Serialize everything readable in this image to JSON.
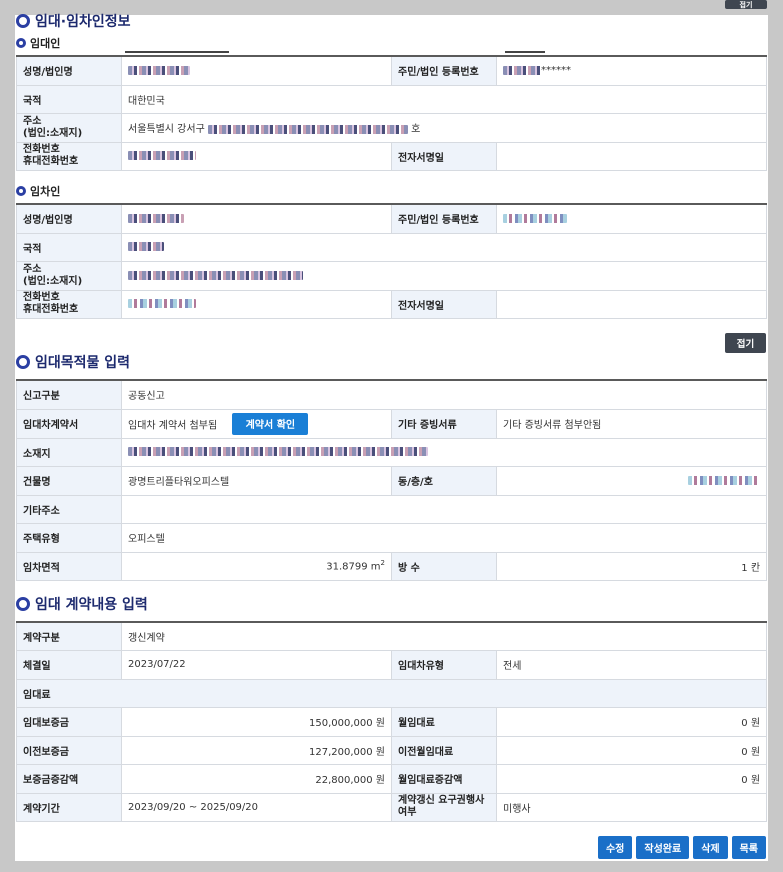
{
  "fold_label": "접기",
  "section1": {
    "title": "임대·임차인정보",
    "lessor": {
      "title": "임대인",
      "name_label": "성명/법인명",
      "regno_label": "주민/법인 등록번호",
      "regno_suffix": "******",
      "nationality_label": "국적",
      "nationality": "대한민국",
      "address_label": "주소\n(법인:소재지)",
      "address_prefix": "서울특별시 강서구",
      "address_suffix": "호",
      "phone_label": "전화번호\n휴대전화번호",
      "esign_label": "전자서명일",
      "esign": ""
    },
    "lessee": {
      "title": "임차인",
      "name_label": "성명/법인명",
      "regno_label": "주민/법인 등록번호",
      "nationality_label": "국적",
      "address_label": "주소\n(법인:소재지)",
      "phone_label": "전화번호\n휴대전화번호",
      "esign_label": "전자서명일",
      "esign": ""
    }
  },
  "section2": {
    "title": "임대목적물 입력",
    "report_type_label": "신고구분",
    "report_type": "공동신고",
    "contract_doc_label": "임대차계약서",
    "contract_doc": "임대차 계약서 첨부됨",
    "contract_confirm_button": "계약서 확인",
    "other_docs_label": "기타 증빙서류",
    "other_docs": "기타 증빙서류 첨부안됨",
    "location_label": "소재지",
    "building_label": "건물명",
    "building": "광명트리플타워오피스텔",
    "unit_label": "동/층/호",
    "other_addr_label": "기타주소",
    "other_addr": "",
    "housing_type_label": "주택유형",
    "housing_type": "오피스텔",
    "area_label": "임차면적",
    "area": "31.8799 m",
    "area_sup": "2",
    "rooms_label": "방 수",
    "rooms": "1 칸"
  },
  "section3": {
    "title": "임대 계약내용 입력",
    "contract_type_label": "계약구분",
    "contract_type": "갱신계약",
    "sign_date_label": "체결일",
    "sign_date": "2023/07/22",
    "lease_type_label": "임대차유형",
    "lease_type": "전세",
    "rent_header": "임대료",
    "deposit_label": "임대보증금",
    "deposit": "150,000,000 원",
    "monthly_label": "월임대료",
    "monthly": "0 원",
    "prev_deposit_label": "이전보증금",
    "prev_deposit": "127,200,000 원",
    "prev_monthly_label": "이전월임대료",
    "prev_monthly": "0 원",
    "deposit_change_label": "보증금증감액",
    "deposit_change": "22,800,000 원",
    "monthly_change_label": "월임대료증감액",
    "monthly_change": "0 원",
    "period_label": "계약기간",
    "period": "2023/09/20 ~ 2025/09/20",
    "renewal_label": "계약갱신 요구권행사\n여부",
    "renewal": "미행사"
  },
  "footer": {
    "edit": "수정",
    "complete": "작성완료",
    "delete": "삭제",
    "list": "목록"
  }
}
